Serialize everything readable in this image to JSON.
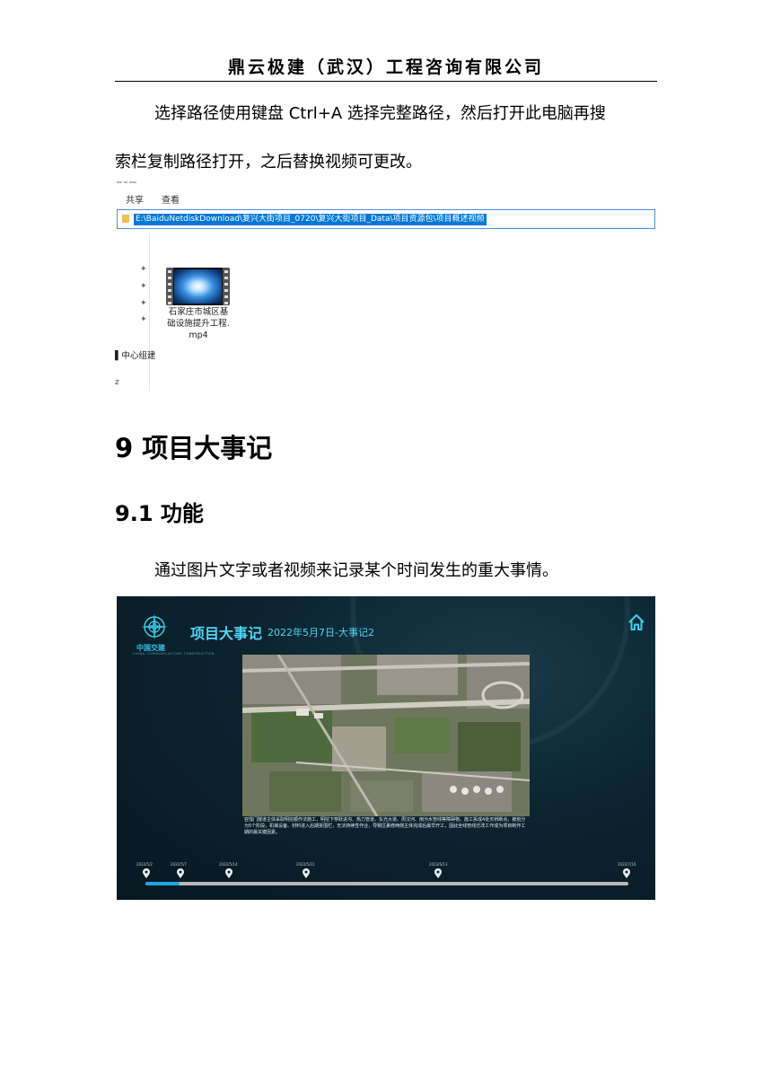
{
  "header": {
    "company": "鼎云极建（武汉）工程咨询有限公司"
  },
  "paragraph1": {
    "line1": "选择路径使用键盘 Ctrl+A 选择完整路径，然后打开此电脑再搜",
    "line2": "索栏复制路径打开，之后替换视频可更改。"
  },
  "explorer": {
    "menu": [
      "共享",
      "查看"
    ],
    "path": "E:\\BaiduNetdiskDownload\\复兴大街项目_0720\\复兴大街项目_Data\\项目资源包\\项目概述视频",
    "file_name_lines": [
      "石家庄市城区基",
      "础设施提升工程.",
      "mp4"
    ],
    "left_panel_text": "中心组建",
    "left_panel_text2": "z"
  },
  "section": {
    "heading": "9  项目大事记",
    "subheading": "9.1  功能"
  },
  "paragraph2": "通过图片文字或者视频来记录某个时间发生的重大事情。",
  "app": {
    "logo_text": "中国交建",
    "logo_sub": "CHINA COMMUNICATIONS CONSTRUCTION",
    "title": "项目大事记",
    "subtitle": "2022年5月7日-大事记2",
    "description": "亚馏门隧道主体采取明挖顺作法施工，明挖下穿跃进沟、热力管道、东光大道、周汉河、雨污水管线等障碍物，施工拆成4处天桥断点，被划分为5个阶段，机械设备、材料进入后期拆围栏，无法持续性作业，导致区裹修两侧主体完成后最早开工，因此全线管线迁改工作成为项目制作工期的最关键因素。",
    "timeline_dates": [
      "2022/5/2",
      "2022/5/7",
      "2022/5/14",
      "2022/5/22",
      "2022/6/13",
      "2022/7/16"
    ],
    "accent": "#4fd6f5",
    "progress_color": "#1aa6e6"
  }
}
